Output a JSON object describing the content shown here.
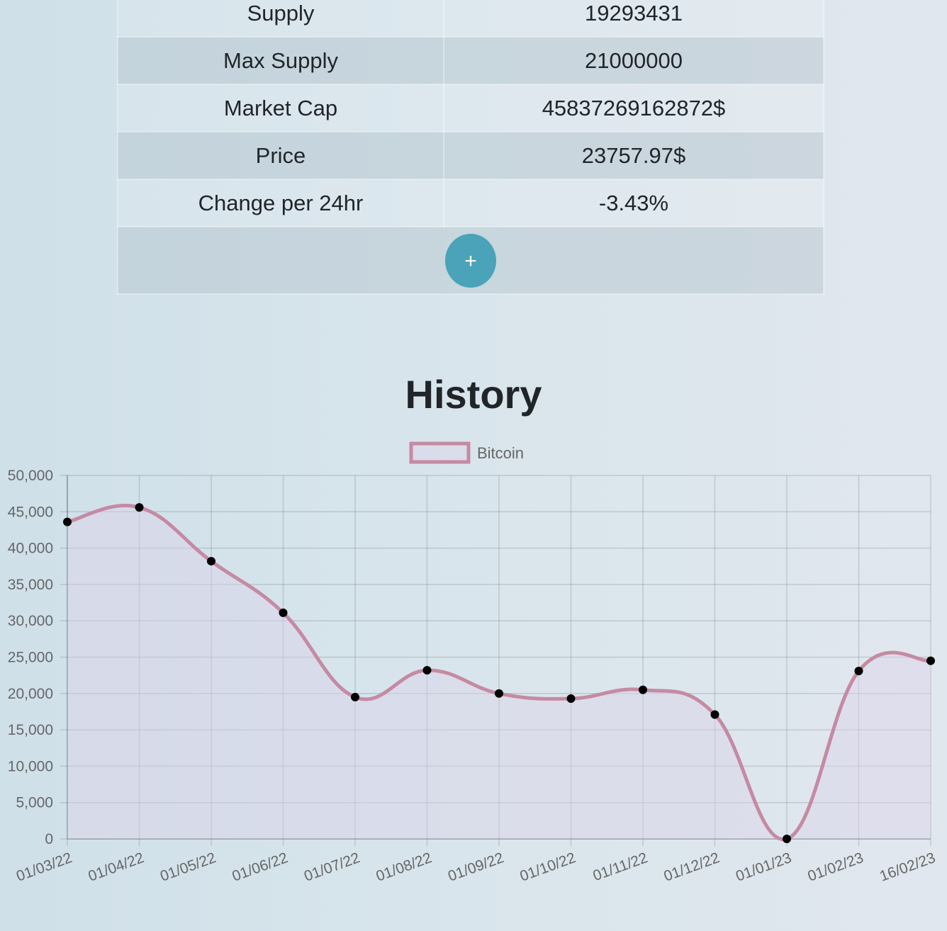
{
  "table": {
    "rows": [
      {
        "label": "Supply",
        "value": "19293431"
      },
      {
        "label": "Max Supply",
        "value": "21000000"
      },
      {
        "label": "Market Cap",
        "value": "45837269162872$"
      },
      {
        "label": "Price",
        "value": "23757.97$"
      },
      {
        "label": "Change per 24hr",
        "value": "-3.43%"
      }
    ],
    "add_label": "+"
  },
  "history_title": "History",
  "chart_data": {
    "type": "line",
    "title": "",
    "xlabel": "",
    "ylabel": "",
    "categories": [
      "01/03/22",
      "01/04/22",
      "01/05/22",
      "01/06/22",
      "01/07/22",
      "01/08/22",
      "01/09/22",
      "01/10/22",
      "01/11/22",
      "01/12/22",
      "01/01/23",
      "01/02/23",
      "16/02/23"
    ],
    "series": [
      {
        "name": "Bitcoin",
        "values": [
          43600,
          45600,
          38200,
          31100,
          19500,
          23200,
          20000,
          19300,
          20500,
          17100,
          0,
          23100,
          24500
        ],
        "line_color": "#c58aa2",
        "fill_color": "rgba(220,210,232,0.45)"
      }
    ],
    "ylim": [
      0,
      50000
    ],
    "yticks": [
      "0",
      "5,000",
      "10,000",
      "15,000",
      "20,000",
      "25,000",
      "30,000",
      "35,000",
      "40,000",
      "45,000",
      "50,000"
    ],
    "grid": true,
    "legend": "top-center"
  }
}
